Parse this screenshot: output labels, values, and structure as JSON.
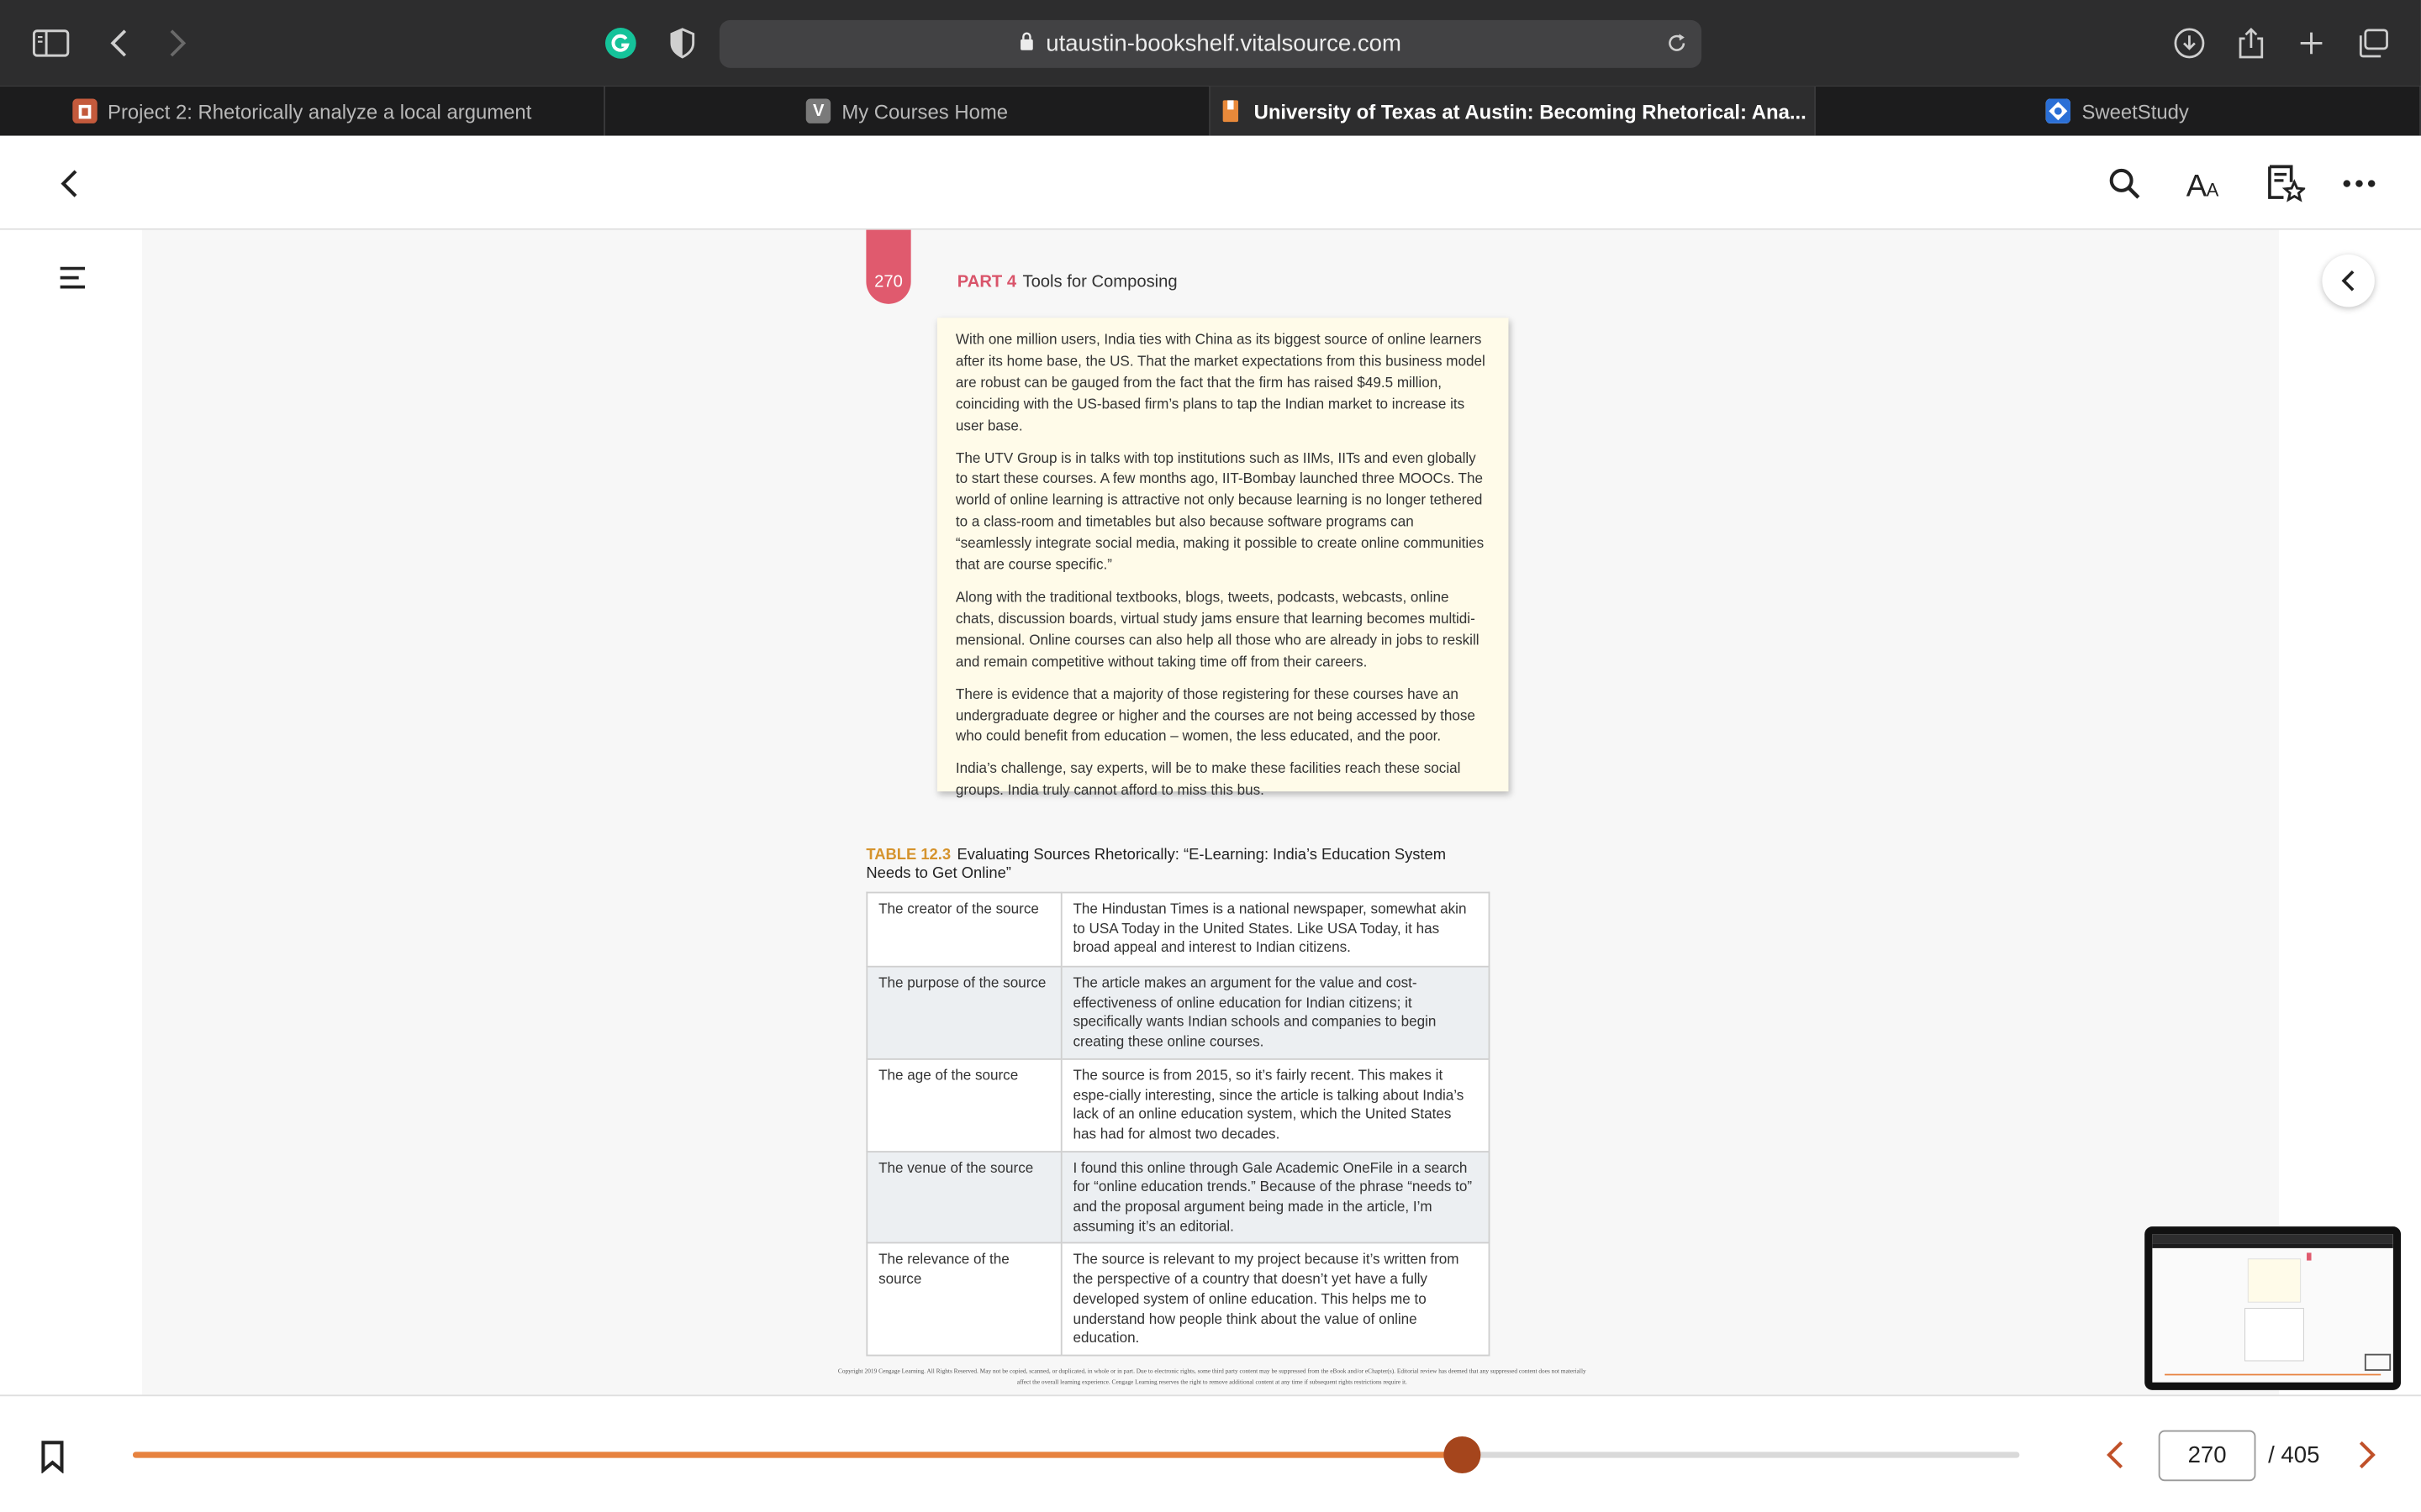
{
  "browser": {
    "url": "utaustin-bookshelf.vitalsource.com",
    "tabs": [
      {
        "label": "Project 2: Rhetorically analyze a local argument",
        "active": false,
        "favicon_color": "#c45a3c",
        "favicon_letter": ""
      },
      {
        "label": "My Courses Home",
        "active": false,
        "favicon_color": "#7a7a7a",
        "favicon_letter": "V"
      },
      {
        "label": "University of Texas at Austin: Becoming Rhetorical: Ana...",
        "active": true,
        "favicon_color": "#e8893a",
        "favicon_letter": ""
      },
      {
        "label": "SweetStudy",
        "active": false,
        "favicon_color": "#2a6fd6",
        "favicon_letter": ""
      }
    ]
  },
  "book": {
    "page_number": "270",
    "part_label": "PART 4",
    "part_title": "Tools for Composing",
    "excerpt_paragraphs": [
      "With one million users, India ties with China as its biggest source of online learners after its home base, the US. That the market expectations from this business model are robust can be gauged from the fact that the firm has raised $49.5 million, coinciding with the US-based firm’s plans to tap the Indian market to increase its user base.",
      "The UTV Group is in talks with top institutions such as IIMs, IITs and even globally to start these courses. A few months ago, IIT-Bombay launched three MOOCs. The world of online learning is attractive not only because learning is no longer tethered to a class-room and timetables but also because software programs can “seamlessly integrate social media, making it possible to create online communities that are course specific.”",
      "Along with the traditional textbooks, blogs, tweets, podcasts, webcasts, online chats, discussion boards, virtual study jams ensure that learning becomes multidi-mensional. Online courses can also help all those who are already in jobs to reskill and remain competitive without taking time off from their careers.",
      "There is evidence that a majority of those registering for these courses have an undergraduate degree or higher and the courses are not being accessed by those who could benefit from education – women, the less educated, and the poor.",
      "India’s challenge, say experts, will be to make these facilities reach these social groups. India truly cannot afford to miss this bus."
    ],
    "table_label": "TABLE 12.3",
    "table_title": "Evaluating Sources Rhetorically: “E-Learning: India’s Education System Needs to Get Online”",
    "table_rows": [
      {
        "key": "The creator of the source",
        "value": "The Hindustan Times is a national newspaper, somewhat akin to USA Today in the United States. Like USA Today, it has broad appeal and interest to Indian citizens."
      },
      {
        "key": "The purpose of the source",
        "value": "The article makes an argument for the value and cost-effectiveness of online education for Indian citizens; it specifically wants Indian schools and companies to begin creating these online courses."
      },
      {
        "key": "The age of the source",
        "value": "The source is from 2015, so it’s fairly recent. This makes it espe-cially interesting, since the article is talking about India’s lack of an online education system, which the United States has had for almost two decades."
      },
      {
        "key": "The venue of the source",
        "value": "I found this online through Gale Academic OneFile in a search for “online education trends.” Because of the phrase “needs to” and the proposal argument being made in the article, I’m assuming it’s an editorial."
      },
      {
        "key": "The relevance of the source",
        "value": "The source is relevant to my project because it’s written from the perspective of a country that doesn’t yet have a fully developed system of online education. This helps me to understand how people think about the value of online education."
      }
    ],
    "copyright": "Copyright 2019 Cengage Learning. All Rights Reserved. May not be copied, scanned, or duplicated, in whole or in part. Due to electronic rights, some third party content may be suppressed from the eBook and/or eChapter(s). Editorial review has deemed that any suppressed content does not materially affect the overall learning experience. Cengage Learning reserves the right to remove additional content at any time if subsequent rights restrictions require it."
  },
  "reader": {
    "current_page": "270",
    "total_pages": "/ 405",
    "progress_fraction": 0.7045
  },
  "colors": {
    "accent": "#e7823f",
    "knob": "#a5451c",
    "ribbon": "#e05a6e"
  }
}
